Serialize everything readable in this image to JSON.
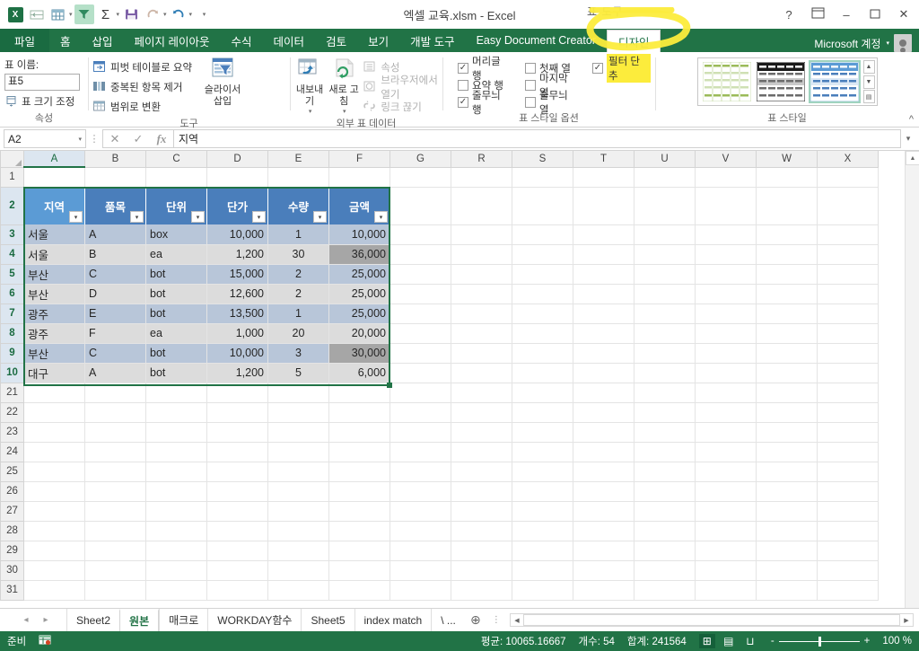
{
  "window": {
    "title": "엑셀 교육.xlsm - Excel",
    "contextual_tools_title": "표 도구",
    "help_icon": "?",
    "ribbon_display_icon": "ribbon-display-options-icon",
    "minimize_icon": "–",
    "maximize_icon": "▢",
    "close_icon": "✕"
  },
  "quick_access": [
    {
      "name": "excel-logo-icon",
      "glyph": "X"
    },
    {
      "name": "quick-print-icon",
      "glyph": "▤"
    },
    {
      "name": "table-format-icon",
      "glyph": "▦",
      "caret": true
    },
    {
      "name": "filter-icon",
      "glyph": "▼",
      "active": true
    },
    {
      "name": "autosum-icon",
      "glyph": "Σ",
      "caret": true
    },
    {
      "name": "save-icon",
      "glyph": "▤"
    },
    {
      "name": "redo-icon",
      "glyph": "↷",
      "caret": true
    },
    {
      "name": "undo-icon",
      "glyph": "↶",
      "caret": true
    },
    {
      "name": "customize-quick-access-icon",
      "glyph": "▾"
    }
  ],
  "ribbon_tabs": [
    {
      "label": "파일",
      "type": "file"
    },
    {
      "label": "홈"
    },
    {
      "label": "삽입"
    },
    {
      "label": "페이지 레이아웃"
    },
    {
      "label": "수식"
    },
    {
      "label": "데이터"
    },
    {
      "label": "검토"
    },
    {
      "label": "보기"
    },
    {
      "label": "개발 도구"
    },
    {
      "label": "Easy Document Creator"
    },
    {
      "label": "디자인",
      "type": "contextual",
      "active": true,
      "highlighted": true
    }
  ],
  "account": {
    "label": "Microsoft 계정",
    "caret": "▾"
  },
  "ribbon": {
    "groups": [
      {
        "title": "속성",
        "table_name_label": "표 이름:",
        "table_name_value": "표5",
        "resize_label": "표 크기 조정",
        "resize_icon": "resize-table-icon"
      },
      {
        "title": "도구",
        "items": [
          {
            "label": "피벗 테이블로 요약",
            "icon": "pivot-table-icon"
          },
          {
            "label": "중복된 항목 제거",
            "icon": "remove-duplicates-icon"
          },
          {
            "label": "범위로 변환",
            "icon": "convert-to-range-icon"
          }
        ],
        "slicer_label": "슬라이서 삽입",
        "slicer_icon": "insert-slicer-icon"
      },
      {
        "title": "외부 표 데이터",
        "export_label": "내보내기",
        "export_icon": "export-icon",
        "refresh_label": "새로 고침",
        "refresh_icon": "refresh-icon",
        "items": [
          {
            "label": "속성",
            "icon": "properties-icon",
            "disabled": true
          },
          {
            "label": "브라우저에서 열기",
            "icon": "open-in-browser-icon",
            "disabled": true
          },
          {
            "label": "링크 끊기",
            "icon": "unlink-icon",
            "disabled": true
          }
        ]
      },
      {
        "title": "표 스타일 옵션",
        "checkboxes": [
          {
            "label": "머리글 행",
            "checked": true
          },
          {
            "label": "첫째 열",
            "checked": false
          },
          {
            "label": "필터 단추",
            "checked": true,
            "highlighted": true
          },
          {
            "label": "요약 행",
            "checked": false
          },
          {
            "label": "마지막 열",
            "checked": false
          },
          {
            "label": "",
            "checked": false,
            "blank": true
          },
          {
            "label": "줄무늬 행",
            "checked": true
          },
          {
            "label": "줄무늬 열",
            "checked": false
          },
          {
            "label": "",
            "checked": false,
            "blank": true
          }
        ]
      },
      {
        "title": "표 스타일",
        "styles": [
          {
            "name": "table-style-green",
            "accent": "#9bbb59",
            "selected": false
          },
          {
            "name": "table-style-dark",
            "accent": "#1a1a1a",
            "selected": false
          },
          {
            "name": "table-style-blue",
            "accent": "#4a7ebb",
            "selected": true
          }
        ],
        "scroll_up": "▲",
        "scroll_down": "▼",
        "more": "▤"
      }
    ],
    "collapse_icon": "^"
  },
  "formula_bar": {
    "name_box": "A2",
    "name_box_caret": "▾",
    "cancel_icon": "✕",
    "enter_icon": "✓",
    "function_icon": "fx",
    "value": "지역",
    "expand_icon": "▾"
  },
  "grid": {
    "columns": [
      "A",
      "B",
      "C",
      "D",
      "E",
      "F",
      "G",
      "R",
      "S",
      "T",
      "U",
      "V",
      "W",
      "X"
    ],
    "selected_column": "A",
    "rows": [
      "1",
      "2",
      "3",
      "4",
      "5",
      "6",
      "7",
      "8",
      "9",
      "10",
      "21",
      "22",
      "23",
      "24",
      "25",
      "26",
      "27",
      "28",
      "29",
      "30",
      "31"
    ],
    "selected_row": "2",
    "table_header": [
      "지역",
      "품목",
      "단위",
      "단가",
      "수량",
      "금액"
    ],
    "filter_glyph": "▾",
    "table_rows": [
      {
        "row": "3",
        "cells": [
          "서울",
          "A",
          "box",
          "10,000",
          "1",
          "10,000"
        ],
        "band": "a",
        "highlight": []
      },
      {
        "row": "4",
        "cells": [
          "서울",
          "B",
          "ea",
          "1,200",
          "30",
          "36,000"
        ],
        "band": "b",
        "highlight": [
          5
        ]
      },
      {
        "row": "5",
        "cells": [
          "부산",
          "C",
          "bot",
          "15,000",
          "2",
          "25,000"
        ],
        "band": "a",
        "highlight": []
      },
      {
        "row": "6",
        "cells": [
          "부산",
          "D",
          "bot",
          "12,600",
          "2",
          "25,000"
        ],
        "band": "b",
        "highlight": []
      },
      {
        "row": "7",
        "cells": [
          "광주",
          "E",
          "bot",
          "13,500",
          "1",
          "25,000"
        ],
        "band": "a",
        "highlight": []
      },
      {
        "row": "8",
        "cells": [
          "광주",
          "F",
          "ea",
          "1,000",
          "20",
          "20,000"
        ],
        "band": "b",
        "highlight": []
      },
      {
        "row": "9",
        "cells": [
          "부산",
          "C",
          "bot",
          "10,000",
          "3",
          "30,000"
        ],
        "band": "a",
        "highlight": [
          5
        ]
      },
      {
        "row": "10",
        "cells": [
          "대구",
          "A",
          "bot",
          "1,200",
          "5",
          "6,000"
        ],
        "band": "b",
        "highlight": []
      }
    ],
    "scroll_up_icon": "▲",
    "scroll_down_icon": "▼"
  },
  "sheet_tabs": {
    "first_icon": "◂",
    "prev_icon": "▸",
    "tabs": [
      {
        "label": "Sheet2",
        "active": false
      },
      {
        "label": "원본",
        "active": true
      },
      {
        "label": "매크로",
        "active": false
      },
      {
        "label": "WORKDAY함수",
        "active": false
      },
      {
        "label": "Sheet5",
        "active": false
      },
      {
        "label": "index match",
        "active": false
      },
      {
        "label": "\\ ...",
        "active": false
      }
    ],
    "add_sheet_icon": "⊕",
    "split_icon": "⋮",
    "hscroll_left": "◀",
    "hscroll_right": "▶"
  },
  "status_bar": {
    "mode": "준비",
    "macro_icon": "record-macro-icon",
    "average": "평균: 10065.16667",
    "count": "개수: 54",
    "sum": "합계: 241564",
    "view_normal_icon": "⊞",
    "view_layout_icon": "▤",
    "view_pagebreak_icon": "⊔",
    "zoom_out": "-",
    "zoom_in": "+",
    "zoom_level": "100 %"
  },
  "colors": {
    "excel_green": "#217346",
    "table_header_blue": "#4a7ebb",
    "table_header_active": "#5b9bd5",
    "band_row": "#b8c6d9",
    "highlight_cell": "#a6a6a6",
    "marker_yellow": "#fcec3c"
  }
}
